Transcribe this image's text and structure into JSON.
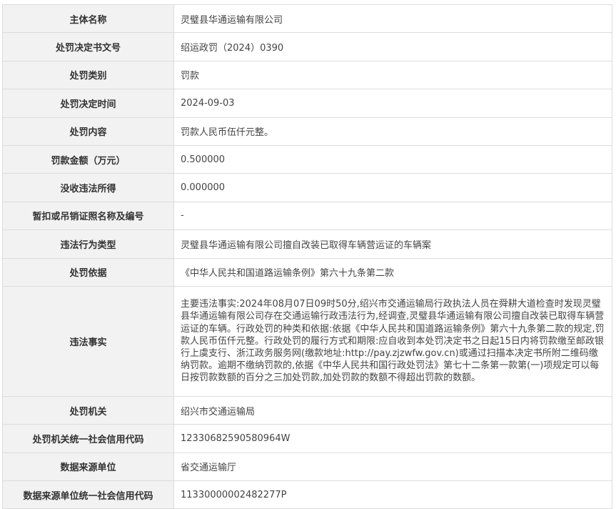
{
  "rows": [
    {
      "label": "主体名称",
      "value": "灵璧县华通运输有限公司"
    },
    {
      "label": "处罚决定书文号",
      "value": "绍运政罚（2024）0390"
    },
    {
      "label": "处罚类别",
      "value": "罚款"
    },
    {
      "label": "处罚决定时间",
      "value": "2024-09-03"
    },
    {
      "label": "处罚内容",
      "value": "罚款人民币伍仟元整。"
    },
    {
      "label": "罚款金额（万元）",
      "value": "0.500000"
    },
    {
      "label": "没收违法所得",
      "value": "0.000000"
    },
    {
      "label": "暂扣或吊销证照名称及编号",
      "value": "-"
    },
    {
      "label": "违法行为类型",
      "value": "灵璧县华通运输有限公司擅自改装已取得车辆营运证的车辆案"
    },
    {
      "label": "处罚依据",
      "value": "《中华人民共和国道路运输条例》第六十九条第二款"
    },
    {
      "label": "违法事实",
      "value": "主要违法事实:2024年08月07日09时50分,绍兴市交通运输局行政执法人员在舜耕大道检查时发现灵璧县华通运输有限公司存在交通运输行政违法行为,经调查,灵璧县华通运输有限公司擅自改装已取得车辆营运证的车辆。行政处罚的种类和依据:依据《中华人民共和国道路运输条例》第六十九条第二款的规定,罚款人民币伍仟元整。行政处罚的履行方式和期限:应自收到本处罚决定书之日起15日内将罚款缴至邮政银行上虞支行、浙江政务服务网(缴款地址:http://pay.zjzwfw.gov.cn)或通过扫描本决定书所附二维码缴纳罚款。逾期不缴纳罚款的,依据《中华人民共和国行政处罚法》第七十二条第一款第(一)项规定可以每日按罚款数额的百分之三加处罚款,加处罚款的数额不得超出罚款的数额。"
    },
    {
      "label": "处罚机关",
      "value": "绍兴市交通运输局"
    },
    {
      "label": "处罚机关统一社会信用代码",
      "value": "12330682590580964W"
    },
    {
      "label": "数据来源单位",
      "value": "省交通运输厅"
    },
    {
      "label": "数据来源单位统一社会信用代码",
      "value": "11330000002482277P"
    }
  ]
}
